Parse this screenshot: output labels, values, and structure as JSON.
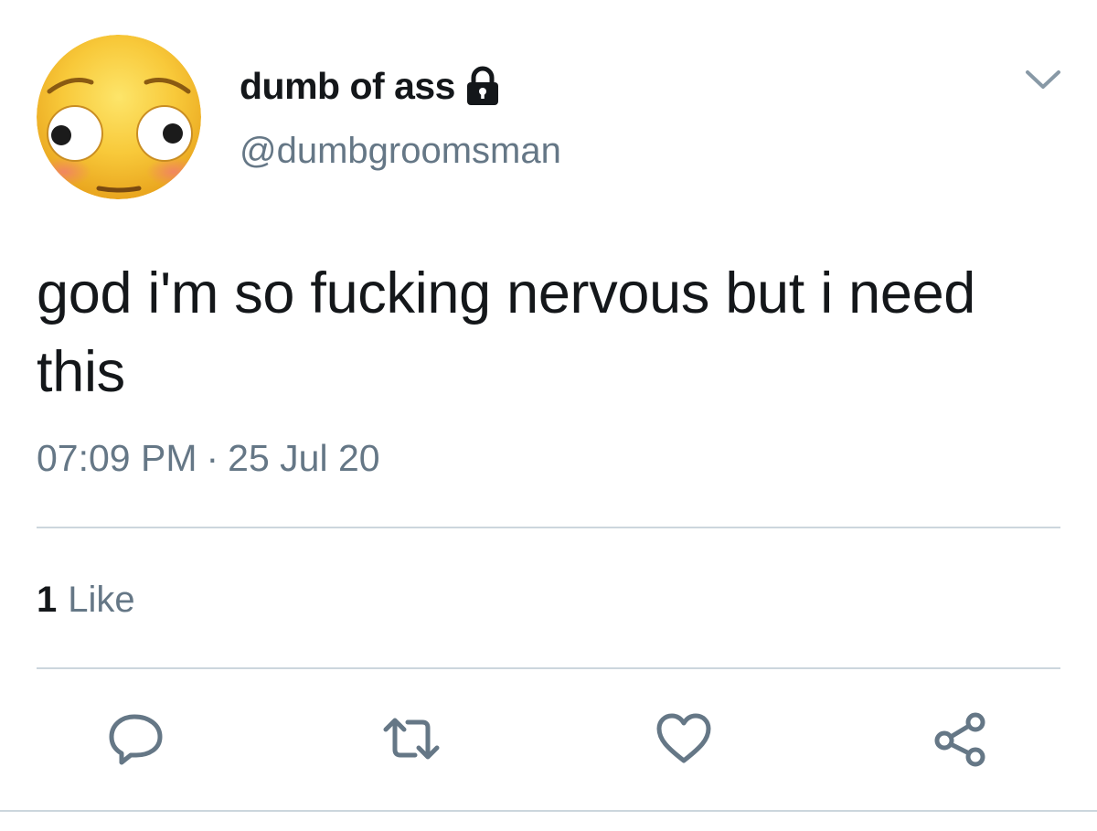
{
  "user": {
    "display_name": "dumb of ass",
    "handle": "@dumbgroomsman",
    "protected": true,
    "avatar": "flushed-face-emoji"
  },
  "tweet": {
    "text": "god i'm so fucking nervous but i need this",
    "time": "07:09 PM",
    "separator": "·",
    "date": "25 Jul 20"
  },
  "stats": {
    "likes_count": "1",
    "likes_label": "Like"
  },
  "actions": {
    "reply_icon": "reply-icon",
    "retweet_icon": "retweet-icon",
    "like_icon": "heart-icon",
    "share_icon": "share-icon"
  },
  "colors": {
    "text_primary": "#14171a",
    "text_secondary": "#657786",
    "divider": "#ccd6dd",
    "icon": "#657786"
  }
}
